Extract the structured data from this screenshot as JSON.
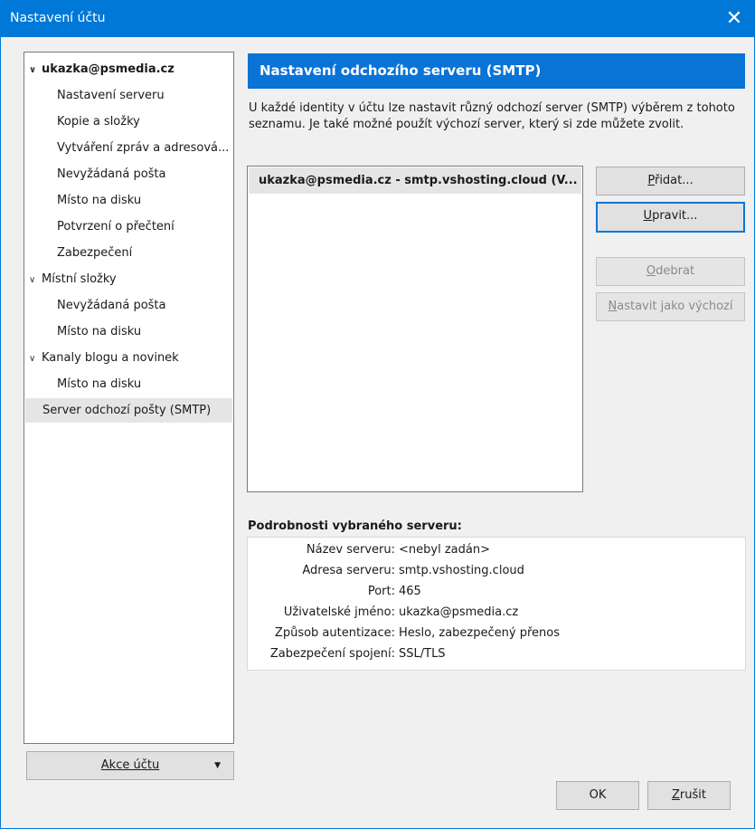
{
  "window": {
    "title": "Nastavení účtu",
    "close_glyph": "✕"
  },
  "tree": {
    "account1": {
      "label": "ukazka@psmedia.cz",
      "children": [
        "Nastavení serveru",
        "Kopie a složky",
        "Vytváření zpráv a adresová...",
        "Nevyžádaná pošta",
        "Místo na disku",
        "Potvrzení o přečtení",
        "Zabezpečení"
      ]
    },
    "local": {
      "label": "Místní složky",
      "children": [
        "Nevyžádaná pošta",
        "Místo na disku"
      ]
    },
    "feeds": {
      "label": "Kanaly blogu a novinek",
      "children": [
        "Místo na disku"
      ]
    },
    "smtp": {
      "label": "Server odchozí pošty (SMTP)"
    },
    "expand_glyph": "∨"
  },
  "account_actions": {
    "label": "Akce účtu",
    "arrow": "▼"
  },
  "panel": {
    "header": "Nastavení odchozího serveru (SMTP)",
    "description": "U každé identity v účtu lze nastavit různý odchozí server (SMTP) výběrem z tohoto seznamu. Je také možné použít výchozí server, který si zde můžete zvolit.",
    "servers": [
      "ukazka@psmedia.cz - smtp.vshosting.cloud (V..."
    ],
    "buttons": {
      "add_pre": "",
      "add_key": "P",
      "add_post": "řidat...",
      "edit_pre": "",
      "edit_key": "U",
      "edit_post": "pravit...",
      "remove_pre": "",
      "remove_key": "O",
      "remove_post": "debrat",
      "default_pre": "",
      "default_key": "N",
      "default_post": "astavit jako výchozí"
    },
    "details_title": "Podrobnosti vybraného serveru:",
    "details": [
      {
        "key": "Název serveru:",
        "value": "<nebyl zadán>"
      },
      {
        "key": "Adresa serveru:",
        "value": "smtp.vshosting.cloud"
      },
      {
        "key": "Port:",
        "value": "465"
      },
      {
        "key": "Uživatelské jméno:",
        "value": "ukazka@psmedia.cz"
      },
      {
        "key": "Způsob autentizace:",
        "value": "Heslo, zabezpečený přenos"
      },
      {
        "key": "Zabezpečení spojení:",
        "value": "SSL/TLS"
      }
    ]
  },
  "footer": {
    "ok": "OK",
    "cancel_key": "Z",
    "cancel_post": "rušit"
  }
}
